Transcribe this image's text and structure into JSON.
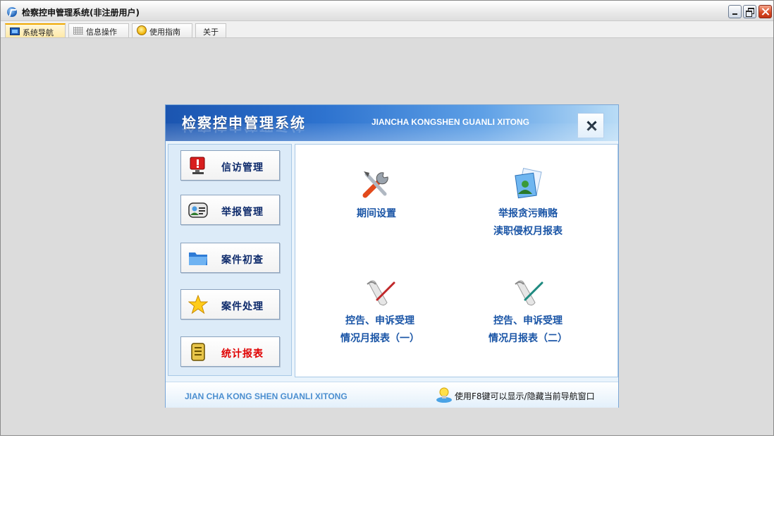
{
  "window": {
    "title": "检察控申管理系统(非注册用户)"
  },
  "tabs": [
    {
      "label": "系统导航",
      "icon": "monitor-icon",
      "active": true
    },
    {
      "label": "信息操作",
      "icon": "grid-icon",
      "active": false
    },
    {
      "label": "使用指南",
      "icon": "help-icon",
      "active": false
    },
    {
      "label": "关于",
      "icon": "",
      "active": false
    }
  ],
  "dialog": {
    "title": "检察控申管理系统",
    "subtitle": "JIANCHA KONGSHEN GUANLI XITONG",
    "nav": [
      {
        "label": "信访管理",
        "icon": "alert-monitor-icon"
      },
      {
        "label": "举报管理",
        "icon": "contact-card-icon"
      },
      {
        "label": "案件初查",
        "icon": "folder-icon"
      },
      {
        "label": "案件处理",
        "icon": "star-icon"
      },
      {
        "label": "统计报表",
        "icon": "report-book-icon",
        "current": true
      }
    ],
    "functions": [
      {
        "line1": "期间设置",
        "line2": "",
        "icon": "tools-icon"
      },
      {
        "line1": "举报贪污贿赂",
        "line2": "渎职侵权月报表",
        "icon": "user-document-icon"
      },
      {
        "line1": "控告、申诉受理",
        "line2": "情况月报表（一）",
        "icon": "scroll-red-pen-icon"
      },
      {
        "line1": "控告、申诉受理",
        "line2": "情况月报表（二）",
        "icon": "scroll-green-pen-icon"
      }
    ],
    "footer": {
      "left_text": "JIAN CHA KONG SHEN GUANLI XITONG",
      "hint": "使用F8键可以显示/隐藏当前导航窗口",
      "hint_icon": "lightbulb-user-icon"
    }
  }
}
